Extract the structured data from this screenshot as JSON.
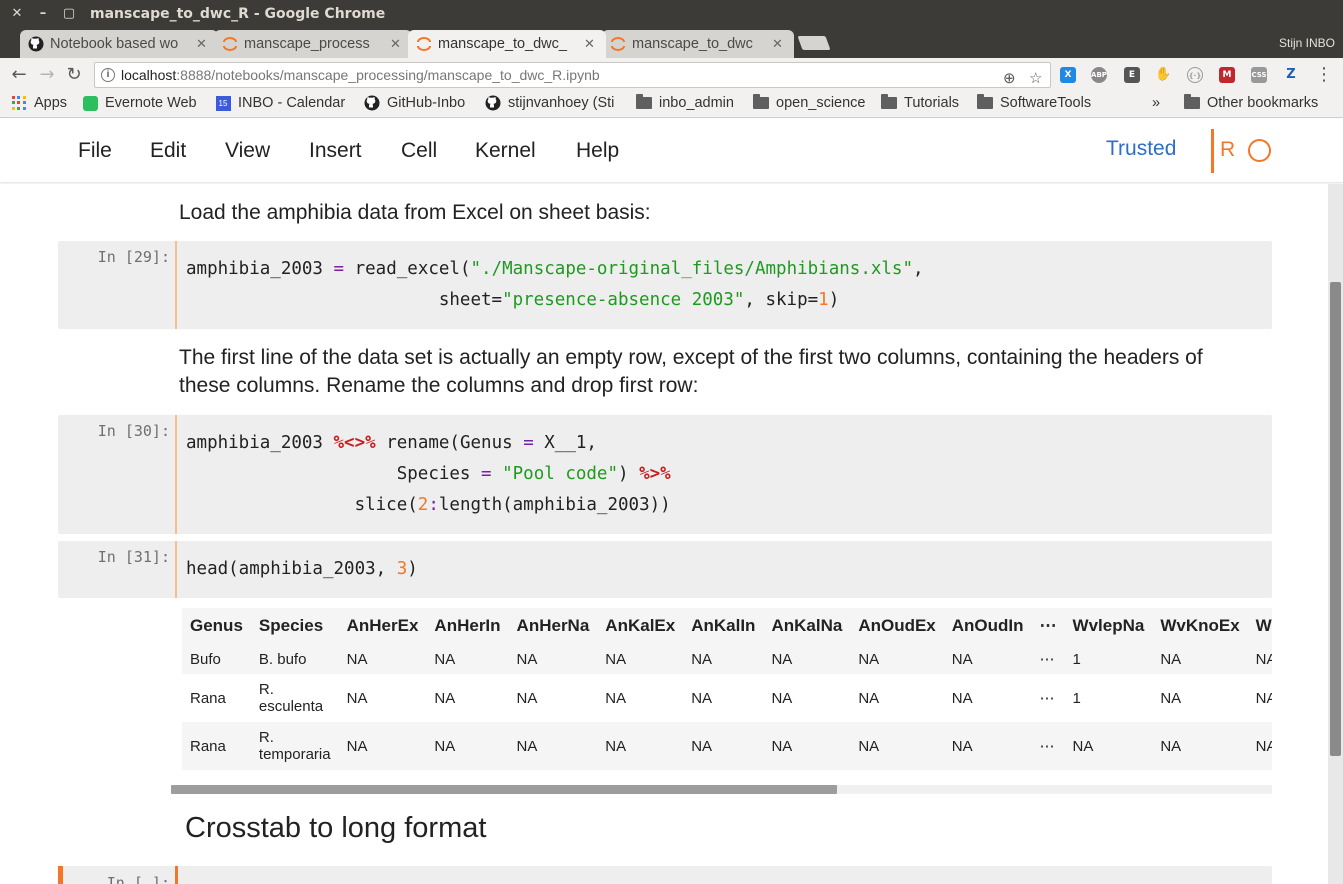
{
  "window": {
    "title": "manscape_to_dwc_R - Google Chrome",
    "buttons": [
      "✕",
      "–",
      "▢"
    ]
  },
  "tabs": [
    {
      "label": "Notebook based wo",
      "icon": "github-icon",
      "active": false
    },
    {
      "label": "manscape_process",
      "icon": "jupyter-icon",
      "active": false
    },
    {
      "label": "manscape_to_dwc_",
      "icon": "jupyter-icon",
      "active": true
    },
    {
      "label": "manscape_to_dwc",
      "icon": "jupyter-icon",
      "active": false
    }
  ],
  "profile": "Stijn INBO",
  "address": {
    "host": "localhost",
    "path": ":8888/notebooks/manscape_processing/manscape_to_dwc_R.ipynb"
  },
  "extensions": [
    {
      "name": "xmarks-extension-icon",
      "text": "X",
      "color": "#1e88e5"
    },
    {
      "name": "adblock-extension-icon",
      "text": "ABP",
      "color": "#888888"
    },
    {
      "name": "evernote-extension-icon",
      "text": "E",
      "color": "#555555"
    },
    {
      "name": "hand-extension-icon",
      "text": "✋",
      "color": "#777777"
    },
    {
      "name": "jsonview-extension-icon",
      "text": "{·}",
      "color": "#9a9a9a"
    },
    {
      "name": "mendeley-extension-icon",
      "text": "M",
      "color": "#c0282e"
    },
    {
      "name": "lastpass-extension-icon",
      "text": "CSS",
      "color": "#999999"
    },
    {
      "name": "zotero-extension-icon",
      "text": "Z",
      "color": "#1e5fb4"
    }
  ],
  "bookmarks": [
    {
      "label": "Apps",
      "icon": "apps-icon"
    },
    {
      "label": "Evernote Web",
      "icon": "evernote-icon"
    },
    {
      "label": "INBO - Calendar",
      "icon": "calendar-icon"
    },
    {
      "label": "GitHub-Inbo",
      "icon": "github-icon"
    },
    {
      "label": "stijnvanhoey (Sti",
      "icon": "github-icon"
    },
    {
      "label": "inbo_admin",
      "icon": "folder-icon"
    },
    {
      "label": "open_science",
      "icon": "folder-icon"
    },
    {
      "label": "Tutorials",
      "icon": "folder-icon"
    },
    {
      "label": "SoftwareTools",
      "icon": "folder-icon"
    }
  ],
  "bookmarks_more": "»",
  "other_bookmarks": "Other bookmarks",
  "jupyter": {
    "menu": [
      "File",
      "Edit",
      "View",
      "Insert",
      "Cell",
      "Kernel",
      "Help"
    ],
    "trusted": "Trusted",
    "kernel": "R"
  },
  "notebook": {
    "md1": "Load the amphibia data from Excel on sheet basis:",
    "cell29_prompt": "In [29]:",
    "md2_line1": "The first line of the data set is actually an empty row, except of the first two columns, containing the headers of",
    "md2_line2": "these columns. Rename the columns and drop first row:",
    "cell30_prompt": "In [30]:",
    "cell31_prompt": "In [31]:",
    "heading": "Crosstab to long format",
    "next_prompt": "In [ ]:"
  },
  "output_table": {
    "columns": [
      "Genus",
      "Species",
      "AnHerEx",
      "AnHerIn",
      "AnHerNa",
      "AnKalEx",
      "AnKalIn",
      "AnKalNa",
      "AnOudEx",
      "AnOudIn",
      "⋯",
      "WvlepNa",
      "WvKnoEx",
      "WvKnoIn"
    ],
    "rows": [
      [
        "Bufo",
        "B. bufo",
        "NA",
        "NA",
        "NA",
        "NA",
        "NA",
        "NA",
        "NA",
        "NA",
        "⋯",
        "1",
        "NA",
        "NA"
      ],
      [
        "Rana",
        "R. esculenta",
        "NA",
        "NA",
        "NA",
        "NA",
        "NA",
        "NA",
        "NA",
        "NA",
        "⋯",
        "1",
        "NA",
        "NA"
      ],
      [
        "Rana",
        "R. temporaria",
        "NA",
        "NA",
        "NA",
        "NA",
        "NA",
        "NA",
        "NA",
        "NA",
        "⋯",
        "NA",
        "NA",
        "NA"
      ]
    ]
  }
}
